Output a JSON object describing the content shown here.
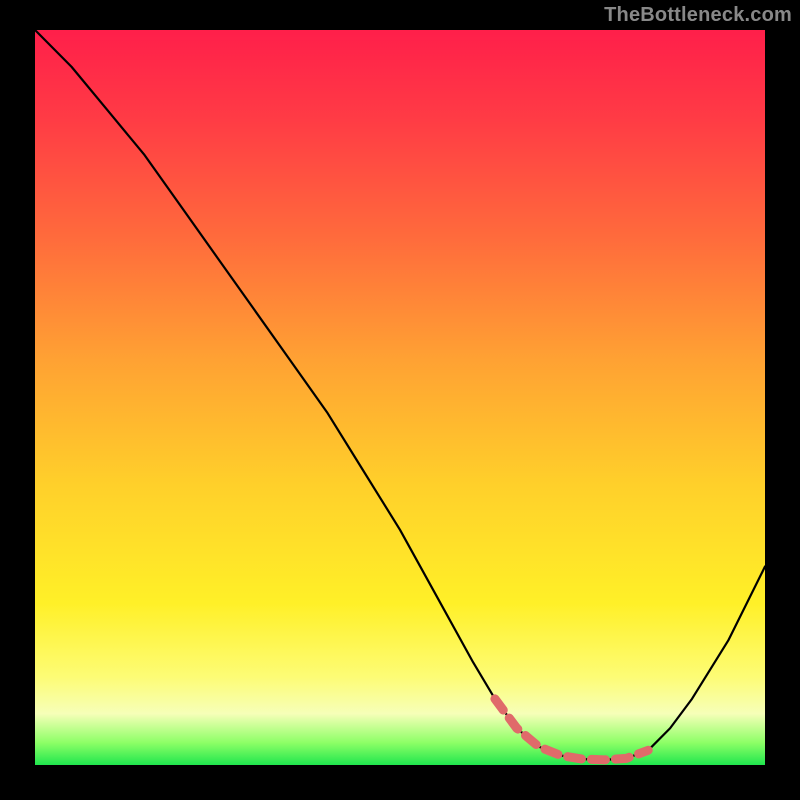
{
  "watermark": "TheBottleneck.com",
  "colors": {
    "background": "#000000",
    "curve": "#000000",
    "highlight": "#e06a6a",
    "watermark": "#888888"
  },
  "chart_data": {
    "type": "line",
    "title": "",
    "xlabel": "",
    "ylabel": "",
    "xlim": [
      0,
      100
    ],
    "ylim": [
      0,
      100
    ],
    "grid": false,
    "series": [
      {
        "name": "bottleneck-curve",
        "x": [
          0,
          5,
          10,
          15,
          20,
          25,
          30,
          35,
          40,
          45,
          50,
          55,
          60,
          63,
          66,
          69,
          72,
          75,
          78,
          81,
          84,
          87,
          90,
          95,
          100
        ],
        "values": [
          100,
          95,
          89,
          83,
          76,
          69,
          62,
          55,
          48,
          40,
          32,
          23,
          14,
          9,
          5,
          2.5,
          1.3,
          0.8,
          0.7,
          0.9,
          2,
          5,
          9,
          17,
          27
        ]
      }
    ],
    "highlight_region": {
      "name": "minimum-bottleneck",
      "x": [
        63,
        66,
        69,
        72,
        75,
        78,
        81,
        84
      ],
      "values": [
        9,
        5,
        2.5,
        1.3,
        0.8,
        0.7,
        0.9,
        2
      ]
    },
    "gradient_stops": [
      {
        "pos": 0,
        "color": "#ff1f4a"
      },
      {
        "pos": 12,
        "color": "#ff3b45"
      },
      {
        "pos": 28,
        "color": "#ff6a3c"
      },
      {
        "pos": 45,
        "color": "#ffa233"
      },
      {
        "pos": 62,
        "color": "#ffd02a"
      },
      {
        "pos": 78,
        "color": "#fff028"
      },
      {
        "pos": 88,
        "color": "#fdfc75"
      },
      {
        "pos": 93,
        "color": "#f6ffb8"
      },
      {
        "pos": 97,
        "color": "#8cff66"
      },
      {
        "pos": 100,
        "color": "#20e64e"
      }
    ]
  }
}
